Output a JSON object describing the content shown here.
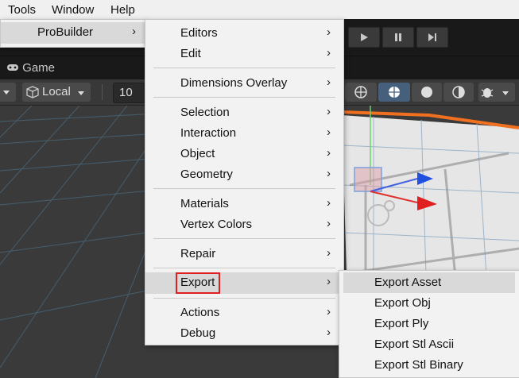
{
  "menubar": {
    "items": [
      "Tools",
      "Window",
      "Help"
    ]
  },
  "tools_menu": {
    "probuilder_label": "ProBuilder"
  },
  "probuilder_menu": {
    "editors": "Editors",
    "edit": "Edit",
    "dimensions_overlay": "Dimensions Overlay",
    "selection": "Selection",
    "interaction": "Interaction",
    "object": "Object",
    "geometry": "Geometry",
    "materials": "Materials",
    "vertex_colors": "Vertex Colors",
    "repair": "Repair",
    "export": "Export",
    "actions": "Actions",
    "debug": "Debug"
  },
  "export_menu": {
    "items": [
      "Export Asset",
      "Export Obj",
      "Export Ply",
      "Export Stl Ascii",
      "Export Stl Binary"
    ]
  },
  "tabs": {
    "game": "Game"
  },
  "scene_toolbar": {
    "pivot_rotation": "Local",
    "grid_size": "10"
  },
  "highlight_color": "#e02020"
}
